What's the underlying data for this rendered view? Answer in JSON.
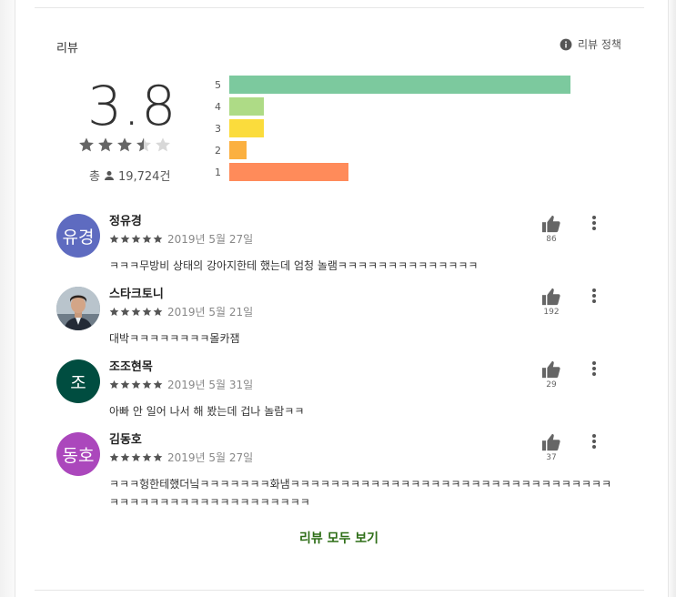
{
  "section": {
    "title": "리뷰",
    "policy_label": "리뷰 정책"
  },
  "summary": {
    "average": "3.8",
    "stars": 3.5,
    "total_prefix": "총",
    "total_count": "19,724건"
  },
  "histogram": [
    {
      "label": "5",
      "fraction": 1.0,
      "color": "#7cc99e"
    },
    {
      "label": "4",
      "fraction": 0.1,
      "color": "#aedb86"
    },
    {
      "label": "3",
      "fraction": 0.1,
      "color": "#fbdc3c"
    },
    {
      "label": "2",
      "fraction": 0.05,
      "color": "#fbb040"
    },
    {
      "label": "1",
      "fraction": 0.35,
      "color": "#ff8b5a"
    }
  ],
  "reviews": [
    {
      "avatar_text": "유경",
      "avatar_color": "#5e6bc0",
      "author": "정유경",
      "stars": 5,
      "date": "2019년 5월 27일",
      "likes": "86",
      "text": "ㅋㅋㅋ무방비 상태의 강아지한테 했는데 엄청 놀램ㅋㅋㅋㅋㅋㅋㅋㅋㅋㅋㅋㅋㅋㅋ"
    },
    {
      "avatar_text": "",
      "avatar_color": "#8a9aa8",
      "author": "스타크토니",
      "stars": 5,
      "date": "2019년 5월 21일",
      "likes": "192",
      "text": "대박ㅋㅋㅋㅋㅋㅋㅋㅋ몰카잼"
    },
    {
      "avatar_text": "조",
      "avatar_color": "#004d40",
      "author": "조조현목",
      "stars": 5,
      "date": "2019년 5월 31일",
      "likes": "29",
      "text": "아빠 안 일어 나서 해 봤는데 겁나 놀람ㅋㅋ"
    },
    {
      "avatar_text": "동호",
      "avatar_color": "#ab47bc",
      "author": "김동호",
      "stars": 5,
      "date": "2019년 5월 27일",
      "likes": "37",
      "text": "ㅋㅋㅋ헝한테했더닠ㅋㅋㅋㅋㅋㅋㅋ화냄ㅋㅋㅋㅋㅋㅋㅋㅋㅋㅋㅋㅋㅋㅋㅋㅋㅋㅋㅋㅋㅋㅋㅋㅋㅋㅋㅋㅋㅋㅋㅋㅋㅋㅋㅋㅋㅋㅋㅋㅋㅋㅋㅋㅋㅋㅋㅋㅋㅋㅋㅋㅋ"
    }
  ],
  "all_reviews_label": "리뷰 모두 보기",
  "icons": {
    "info": "info-icon",
    "person": "person-icon",
    "thumb": "thumb-up-icon",
    "more": "more-vert-icon",
    "star": "star-icon"
  }
}
